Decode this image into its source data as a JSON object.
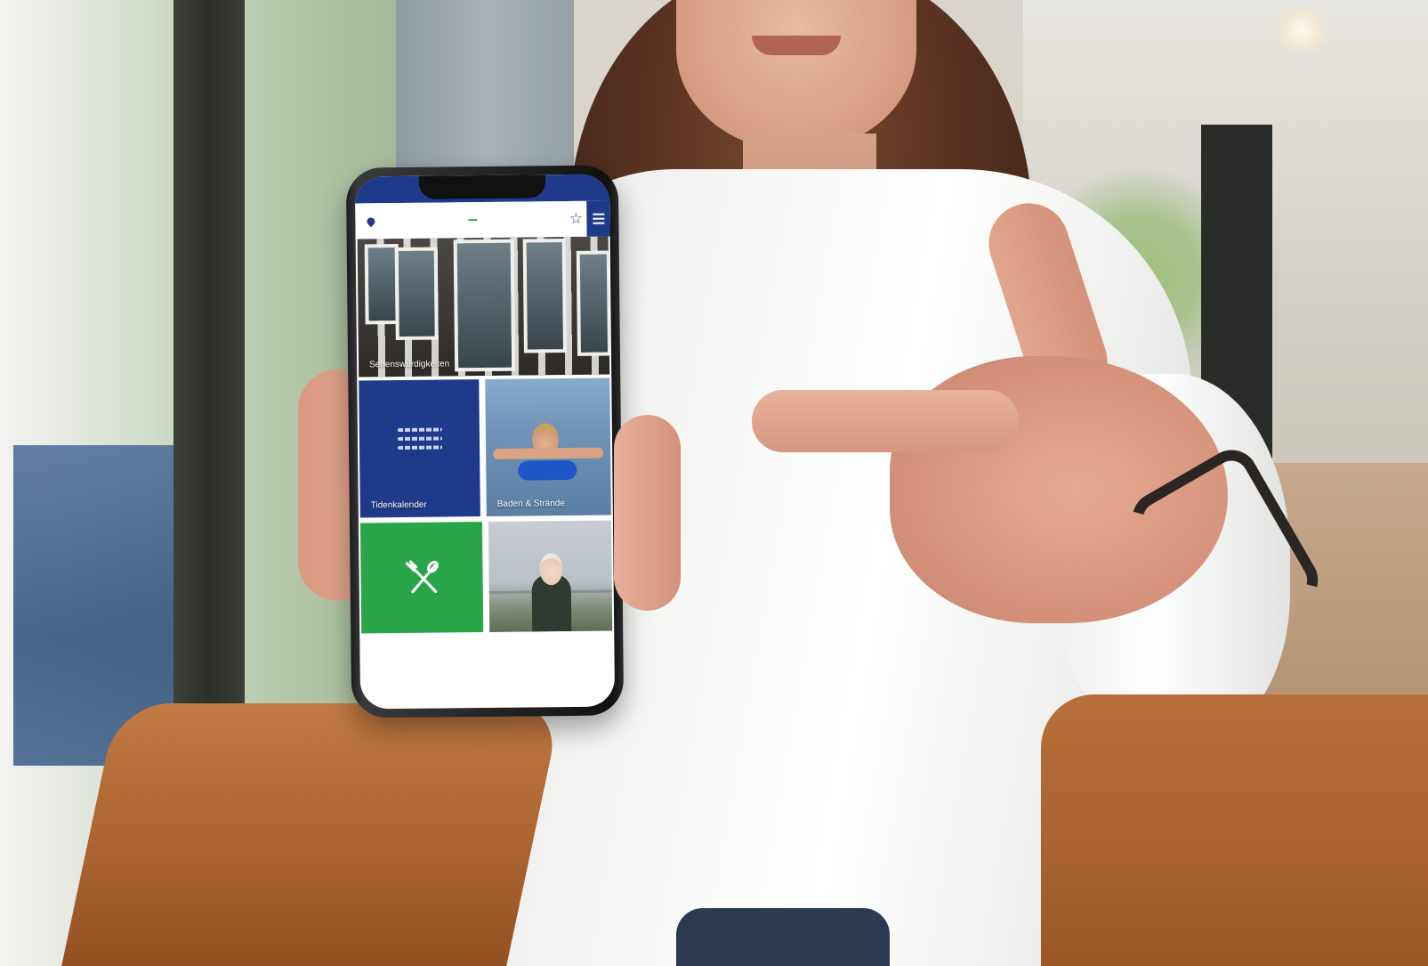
{
  "app": {
    "logo": {
      "top_text": "",
      "mark": "",
      "sub_text": ""
    },
    "icons": {
      "location": "map-pin-icon",
      "favorite": "star-outline-icon",
      "menu": "hamburger-menu-icon"
    },
    "tiles": [
      {
        "label": "Sehenswürdigkeiten",
        "color": ""
      },
      {
        "label": "Tidenkalender",
        "color": "#1f3a8a",
        "icon": "waves-icon"
      },
      {
        "label": "Baden & Strände",
        "color": ""
      },
      {
        "label": "",
        "color": "#2aa64a",
        "icon": "cutlery-icon"
      },
      {
        "label": "",
        "color": ""
      }
    ]
  },
  "colors": {
    "brand_blue": "#1f3a8a",
    "brand_green": "#2aa64a"
  }
}
